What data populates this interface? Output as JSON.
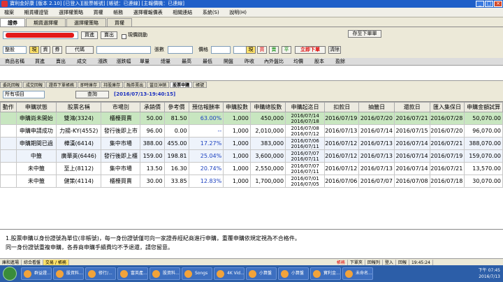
{
  "window": {
    "title": "寶利金好康 [版本 2.10] [已登入][股票帳號] [帳號：已連線] [主報價機：已連線]"
  },
  "menu": [
    "檔案",
    "期貨權證管",
    "選擇權策略",
    "買權",
    "帳務",
    "選擇權報價表",
    "相關連結",
    "系統(S)",
    "說明(H)"
  ],
  "top_tabs": [
    "證券",
    "期貨選擇權",
    "選擇權策略",
    "買權"
  ],
  "order": {
    "account_placeholder": "",
    "buy_label": "買進",
    "sell_label": "賣出",
    "current_stock_label": "現價跳動",
    "save_order_label": "存至下單單",
    "type_value": "整股",
    "cash_label": "現",
    "financing_label": "資",
    "short_label": "券",
    "code_label": "代碼",
    "qty_label": "張數",
    "price_label": "價格",
    "cash2_label": "現",
    "buy2_label": "買",
    "sell2_label": "賣",
    "flat_label": "平",
    "submit_label": "立即下單",
    "clear_label": "清除"
  },
  "quote_headers": [
    "商品名稱",
    "買進",
    "賣出",
    "成交",
    "漲跌",
    "漲跌幅",
    "單量",
    "總量",
    "最高",
    "最低",
    "開盤",
    "昨收",
    "內外盤比",
    "均價",
    "股本",
    "盈餘"
  ],
  "sub_tabs": [
    "委託回報",
    "成交回報",
    "證券下單帳務",
    "即時庫存",
    "持股庫存",
    "融券賣出",
    "當日沖銷",
    "股票申購",
    "帳號"
  ],
  "filter": {
    "select_value": "所有項目",
    "query_label": "查詢",
    "timestamp": "[2016/07/13-19:40:15]"
  },
  "grid": {
    "headers": [
      "動作",
      "申購狀態",
      "股票名稱",
      "市場別",
      "承銷價",
      "參考價",
      "預估報酬率",
      "申購股數",
      "申購總股數",
      "申購起迄日",
      "扣款日",
      "抽籤日",
      "還款日",
      "匯入集保日",
      "申購金額試算"
    ],
    "rows": [
      {
        "action": "",
        "status": "申購尚未開始",
        "name": "雙鴻(3324)",
        "market": "櫃檯買賣",
        "price": "50.00",
        "ref": "81.50",
        "ret": "63.00%",
        "qty": "1,000",
        "total": "450,000",
        "start": "2016/07/14",
        "end": "2016/07/18",
        "debit": "2016/07/19",
        "lottery": "2016/07/20",
        "refund": "2016/07/21",
        "deposit": "2016/07/28",
        "amount": "50,070.00"
      },
      {
        "action": "",
        "status": "申購申請成功",
        "name": "力揚-KY(4552)",
        "market": "發行後即上市",
        "price": "96.00",
        "ref": "0.00",
        "ret": "--",
        "qty": "1,000",
        "total": "2,010,000",
        "start": "2016/07/08",
        "end": "2016/07/12",
        "debit": "2016/07/13",
        "lottery": "2016/07/14",
        "refund": "2016/07/15",
        "deposit": "2016/07/20",
        "amount": "96,070.00"
      },
      {
        "action": "",
        "status": "申購期間已過",
        "name": "樺漢(6414)",
        "market": "集中市場",
        "price": "388.00",
        "ref": "455.00",
        "ret": "17.27%",
        "qty": "1,000",
        "total": "383,000",
        "start": "2016/07/06",
        "end": "2016/07/11",
        "debit": "2016/07/12",
        "lottery": "2016/07/13",
        "refund": "2016/07/14",
        "deposit": "2016/07/21",
        "amount": "388,070.00"
      },
      {
        "action": "",
        "status": "中籤",
        "name": "廣華英(6446)",
        "market": "發行後即上櫃",
        "price": "159.00",
        "ref": "198.81",
        "ret": "25.04%",
        "qty": "1,000",
        "total": "3,600,000",
        "start": "2016/07/07",
        "end": "2016/07/11",
        "debit": "2016/07/12",
        "lottery": "2016/07/13",
        "refund": "2016/07/14",
        "deposit": "2016/07/19",
        "amount": "159,070.00"
      },
      {
        "action": "",
        "status": "未中籤",
        "name": "至上(8112)",
        "market": "集中市場",
        "price": "13.50",
        "ref": "16.30",
        "ret": "20.74%",
        "qty": "1,000",
        "total": "2,550,000",
        "start": "2016/07/07",
        "end": "2016/07/11",
        "debit": "2016/07/12",
        "lottery": "2016/07/13",
        "refund": "2016/07/14",
        "deposit": "2016/07/21",
        "amount": "13,570.00"
      },
      {
        "action": "",
        "status": "未中籤",
        "name": "健策(4114)",
        "market": "櫃檯買賣",
        "price": "30.00",
        "ref": "33.85",
        "ret": "12.83%",
        "qty": "1,000",
        "total": "1,700,000",
        "start": "2016/07/01",
        "end": "2016/07/05",
        "debit": "2016/07/06",
        "lottery": "2016/07/07",
        "refund": "2016/07/08",
        "deposit": "2016/07/18",
        "amount": "30,070.00"
      }
    ]
  },
  "notice": {
    "line1": "1.股票申購以身份證號為單位(非帳號)，每一身份證號僅可向一家證券經紀商進行申購，重覆申購依規定視為不合格件。",
    "line2": "同一身份證號重複申購，各券商申購手續費均不予退還，請您留意。"
  },
  "status_bar": [
    "庫和進場",
    "綜合看盤",
    "交易 / 帳務",
    "",
    "",
    "",
    "",
    "帳務",
    "下單夾",
    "回報列",
    "登入",
    "回報",
    "19:45:24"
  ],
  "taskbar": {
    "apps": [
      "群益證...",
      "股資料...",
      "修行/...",
      "富英產...",
      "股資料...",
      "Songs",
      "4K Vid...",
      "小算盤",
      "小算盤",
      "寶利金...",
      "未命名..."
    ],
    "time": "下午 07:45",
    "date": "2016/7/13"
  },
  "colors": {
    "accent_green": "#c8e6c0",
    "blue_text": "#1a3fbf",
    "alt_row": "#eef3fb"
  }
}
